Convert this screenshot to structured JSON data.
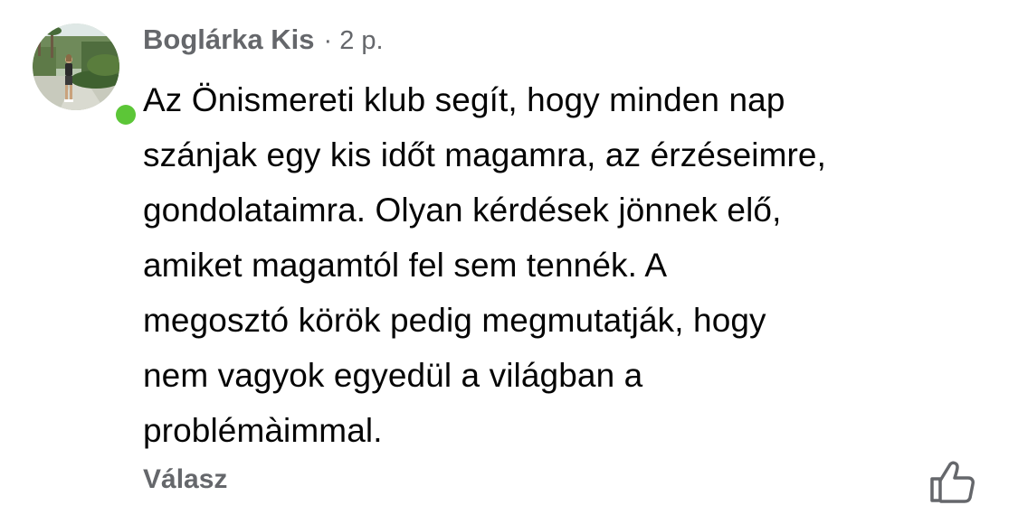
{
  "comment": {
    "author": "Boglárka Kis",
    "separator": "·",
    "time": "2 p.",
    "text": "Az Önismereti klub segít, hogy minden nap\nszánjak egy kis időt magamra, az érzéseimre,\ngondolataimra. Olyan kérdések jönnek elő,\namiket magamtól fel sem tennék. A\nmegosztó körök pedig megmutatják, hogy\nnem vagyok egyedül a világban a\nproblémàimmal.",
    "reply_label": "Válasz",
    "online": true
  },
  "icons": {
    "like": "thumbs-up-icon",
    "presence": "online-status-icon"
  },
  "colors": {
    "secondary_text": "#65676b",
    "primary_text": "#050505",
    "online_green": "#5cc637"
  }
}
